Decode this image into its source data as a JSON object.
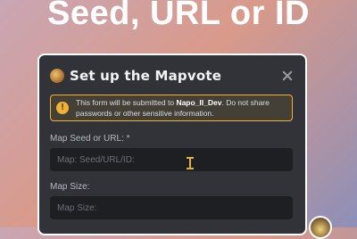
{
  "hero": {
    "title": "Seed, URL or ID"
  },
  "modal": {
    "title": "Set up the Mapvote",
    "warning": {
      "prefix": "This form will be submitted to ",
      "bot_name": "Napo_II_Dev",
      "suffix": ". Do not share passwords or other sensitive information."
    },
    "fields": [
      {
        "label": "Map Seed or URL: *",
        "placeholder": "Map: Seed/URL/ID:"
      },
      {
        "label": "Map Size:",
        "placeholder": "Map Size:"
      }
    ]
  },
  "colors": {
    "accent_warning": "#f0b232",
    "modal_bg": "#313338",
    "input_bg": "#1e1f22"
  }
}
